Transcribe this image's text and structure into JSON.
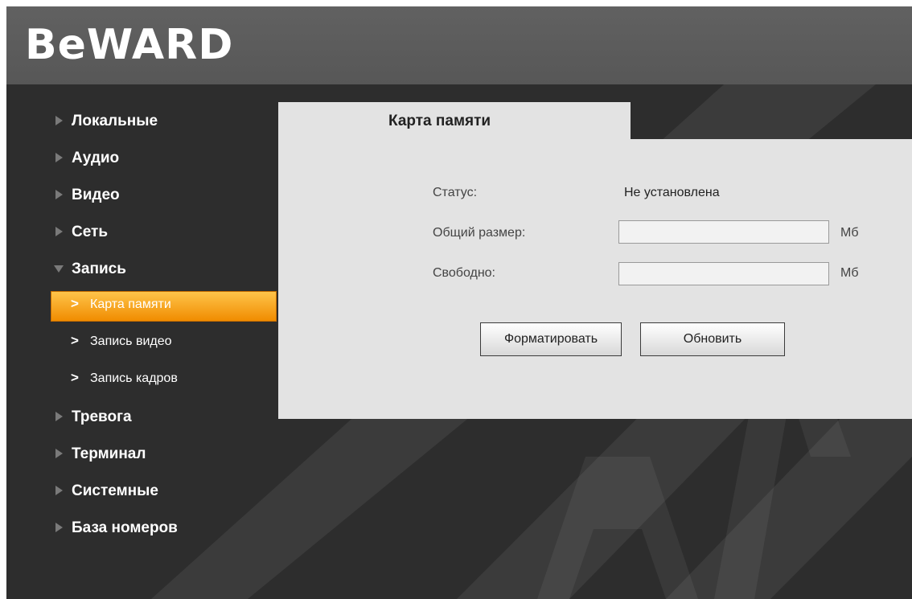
{
  "header": {
    "logo_text": "BeWARD"
  },
  "sidebar": {
    "items": [
      {
        "label": "Локальные",
        "expanded": false
      },
      {
        "label": "Аудио",
        "expanded": false
      },
      {
        "label": "Видео",
        "expanded": false
      },
      {
        "label": "Сеть",
        "expanded": false
      },
      {
        "label": "Запись",
        "expanded": true
      },
      {
        "label": "Тревога",
        "expanded": false
      },
      {
        "label": "Терминал",
        "expanded": false
      },
      {
        "label": "Системные",
        "expanded": false
      },
      {
        "label": "База номеров",
        "expanded": false
      }
    ],
    "subitems": [
      {
        "chevron": ">",
        "label": "Карта памяти",
        "active": true
      },
      {
        "chevron": ">",
        "label": "Запись видео",
        "active": false
      },
      {
        "chevron": ">",
        "label": "Запись кадров",
        "active": false
      }
    ]
  },
  "tab": {
    "title": "Карта памяти"
  },
  "form": {
    "status_label": "Статус:",
    "status_value": "Не установлена",
    "total_label": "Общий размер:",
    "total_value": "",
    "total_unit": "Мб",
    "free_label": "Свободно:",
    "free_value": "",
    "free_unit": "Мб"
  },
  "buttons": {
    "format_label": "Форматировать",
    "refresh_label": "Обновить"
  },
  "colors": {
    "header_bg": "#5c5c5c",
    "body_bg": "#2d2d2d",
    "panel_bg": "#e3e3e3",
    "active_accent": "#f39800"
  }
}
